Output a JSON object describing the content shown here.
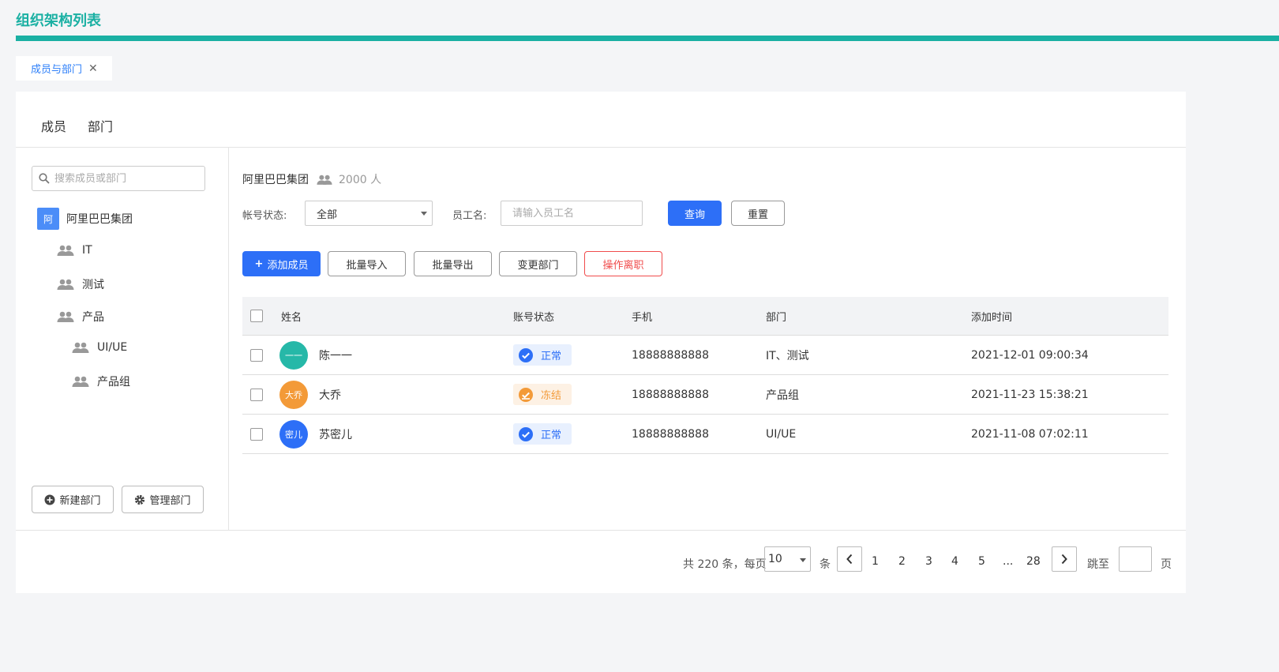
{
  "page": {
    "title": "组织架构列表"
  },
  "tab_chip": {
    "label": "成员与部门",
    "close": "✕"
  },
  "top_tabs": [
    {
      "label": "成员"
    },
    {
      "label": "部门"
    }
  ],
  "sidebar": {
    "search_placeholder": "搜索成员或部门",
    "root": {
      "badge": "阿",
      "label": "阿里巴巴集团"
    },
    "items": [
      {
        "label": "IT"
      },
      {
        "label": "测试"
      },
      {
        "label": "产品"
      },
      {
        "label": "UI/UE"
      },
      {
        "label": "产品组"
      }
    ],
    "new_dept_label": "新建部门",
    "manage_dept_label": "管理部门"
  },
  "main": {
    "org_name": "阿里巴巴集团",
    "member_count": "2000 人",
    "filters": {
      "status_label": "帐号状态:",
      "status_value": "全部",
      "name_label": "员工名:",
      "name_placeholder": "请输入员工名",
      "query_label": "查询",
      "reset_label": "重置"
    },
    "toolbar": {
      "add_label": "添加成员",
      "import_label": "批量导入",
      "export_label": "批量导出",
      "change_dept_label": "变更部门",
      "resign_label": "操作离职"
    },
    "table": {
      "columns": [
        "姓名",
        "账号状态",
        "手机",
        "部门",
        "添加时间"
      ],
      "rows": [
        {
          "avatar_text": "一一",
          "avatar_color": "#26b8a8",
          "name": "陈一一",
          "status": "正常",
          "status_type": "normal",
          "phone": "18888888888",
          "dept": "IT、测试",
          "time": "2021-12-01 09:00:34"
        },
        {
          "avatar_text": "大乔",
          "avatar_color": "#f39a38",
          "name": "大乔",
          "status": "冻结",
          "status_type": "frozen",
          "phone": "18888888888",
          "dept": "产品组",
          "time": "2021-11-23 15:38:21"
        },
        {
          "avatar_text": "密儿",
          "avatar_color": "#2d6ff7",
          "name": "苏密儿",
          "status": "正常",
          "status_type": "normal",
          "phone": "18888888888",
          "dept": "UI/UE",
          "time": "2021-11-08 07:02:11"
        }
      ]
    }
  },
  "pagination": {
    "total_text": "共 220 条，每页",
    "page_size": "10",
    "unit": "条",
    "pages": [
      "1",
      "2",
      "3",
      "4",
      "5",
      "...",
      "28"
    ],
    "jump_label": "跳至",
    "page_label": "页"
  },
  "colors": {
    "accent": "#1ab0a3",
    "primary": "#2d6ff7",
    "danger": "#f04c4c",
    "normal_bg": "#e8f0fe",
    "frozen_bg": "#fdf1e4",
    "frozen_text": "#f39a38"
  }
}
